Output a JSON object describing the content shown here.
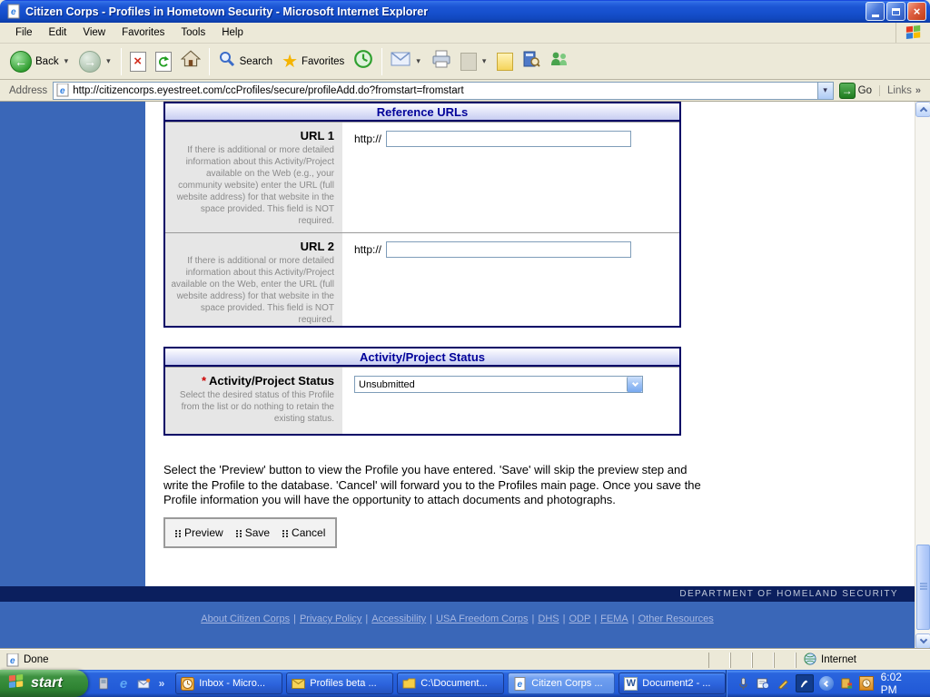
{
  "window": {
    "title": "Citizen Corps - Profiles in Hometown Security - Microsoft Internet Explorer"
  },
  "menu": {
    "items": [
      "File",
      "Edit",
      "View",
      "Favorites",
      "Tools",
      "Help"
    ]
  },
  "toolbar": {
    "back_label": "Back",
    "search_label": "Search",
    "favorites_label": "Favorites"
  },
  "address": {
    "label": "Address",
    "url": "http://citizencorps.eyestreet.com/ccProfiles/secure/profileAdd.do?fromstart=fromstart",
    "go_label": "Go",
    "links_label": "Links"
  },
  "page": {
    "reference_urls": {
      "header": "Reference URLs",
      "url1": {
        "label": "URL 1",
        "description": "If there is additional or more detailed information about this Activity/Project available on the Web (e.g., your community website) enter the URL (full website address) for that website in the space provided. This field is NOT required.",
        "prefix": "http://",
        "value": ""
      },
      "url2": {
        "label": "URL 2",
        "description": "If there is additional or more detailed information about this Activity/Project available on the Web, enter the URL (full website address) for that website in the space provided. This field is NOT required.",
        "prefix": "http://",
        "value": ""
      }
    },
    "status_section": {
      "header": "Activity/Project Status",
      "required_marker": "*",
      "label": "Activity/Project Status",
      "description": "Select the desired status of this Profile from the list or do nothing to retain the existing status.",
      "selected_value": "Unsubmitted"
    },
    "instructions": "Select the 'Preview' button to view the Profile you have entered. 'Save' will skip the preview step and write the Profile to the database. 'Cancel' will forward you to the Profiles main page. Once you save the Profile information you will have the opportunity to attach documents and photographs.",
    "actions": {
      "preview": "Preview",
      "save": "Save",
      "cancel": "Cancel"
    }
  },
  "footer": {
    "dhs_text": "DEPARTMENT OF HOMELAND SECURITY",
    "separator": "|",
    "links": [
      "About Citizen Corps",
      "Privacy Policy",
      "Accessibility",
      "USA Freedom Corps",
      "DHS",
      "ODP",
      "FEMA",
      "Other Resources"
    ]
  },
  "statusbar": {
    "status": "Done",
    "zone": "Internet"
  },
  "taskbar": {
    "start_label": "start",
    "tasks": [
      {
        "label": "Inbox - Micro..."
      },
      {
        "label": "Profiles beta ..."
      },
      {
        "label": "C:\\Document..."
      },
      {
        "label": "Citizen Corps ..."
      },
      {
        "label": "Document2 - ..."
      }
    ],
    "clock": "6:02 PM"
  },
  "icons": {
    "back_arrow": "←",
    "forward_arrow": "→",
    "dropdown": "▾",
    "close_x": "×",
    "stop_x": "×",
    "star": "★",
    "double_chevron": "»",
    "go_arrow": "→",
    "word_w": "W",
    "ie_e": "e"
  },
  "colors": {
    "sidebar_blue": "#3A67B8",
    "navy": "#0B1F5E",
    "header_text": "#000099",
    "header_fill": "#C7CDF2",
    "link_color": "#A6B7E2",
    "required_red": "#CC0000"
  }
}
